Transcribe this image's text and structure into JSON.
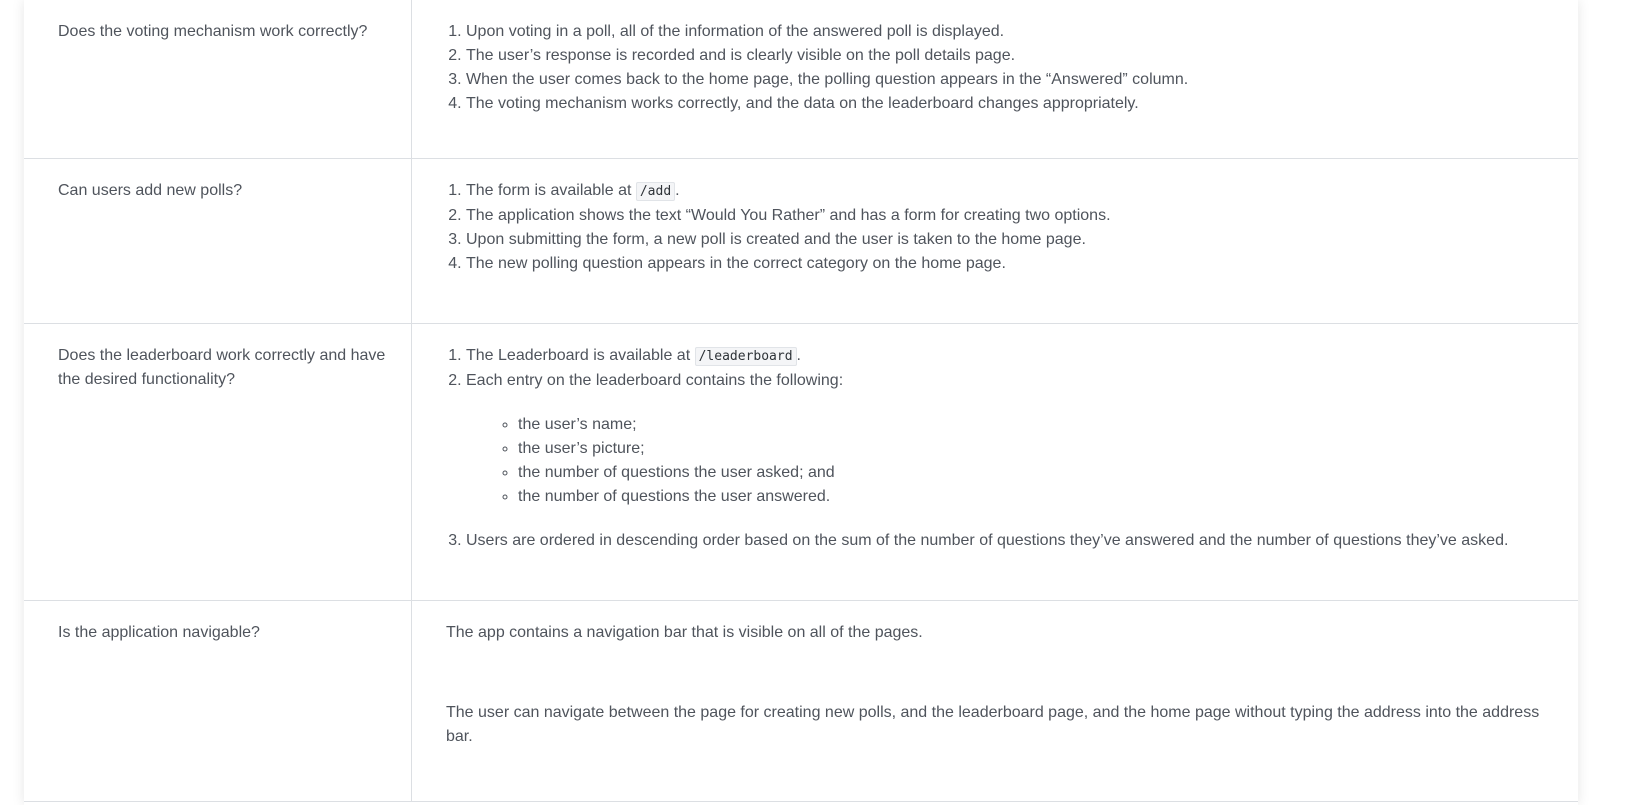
{
  "rows": [
    {
      "criteria": "Does the voting mechanism work correctly?",
      "items": [
        "Upon voting in a poll, all of the information of the answered poll is displayed.",
        "The user’s response is recorded and is clearly visible on the poll details page.",
        "When the user comes back to the home page, the polling question appears in the “Answered” column.",
        "The voting mechanism works correctly, and the data on the leaderboard changes appropriately."
      ]
    },
    {
      "criteria": "Can users add new polls?",
      "item1_prefix": "The form is available at",
      "item1_code": "/add",
      "item1_suffix": ".",
      "items": [
        "The application shows the text “Would You Rather” and has a form for creating two options.",
        "Upon submitting the form, a new poll is created and the user is taken to the home page.",
        "The new polling question appears in the correct category on the home page."
      ]
    },
    {
      "criteria": "Does the leaderboard work correctly and have the desired functionality?",
      "item1_prefix": "The Leaderboard is available at",
      "item1_code": "/leaderboard",
      "item1_suffix": ".",
      "item2": "Each entry on the leaderboard contains the following:",
      "subitems": [
        "the user’s name;",
        "the user’s picture;",
        "the number of questions the user asked; and",
        "the number of questions the user answered."
      ],
      "item3": "Users are ordered in descending order based on the sum of the number of questions they’ve answered and the number of questions they’ve asked."
    },
    {
      "criteria": "Is the application navigable?",
      "paragraphs": [
        "The app contains a navigation bar that is visible on all of the pages.",
        "The user can navigate between the page for creating new polls, and the leaderboard page, and the home page without typing the address into the address bar."
      ]
    }
  ]
}
